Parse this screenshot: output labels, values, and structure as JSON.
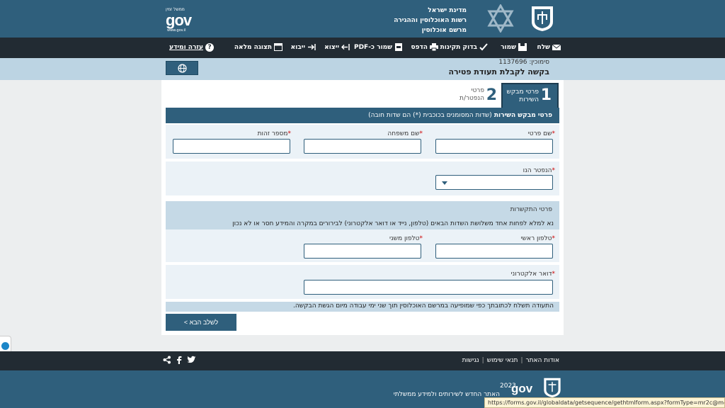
{
  "header": {
    "gov_small": "ממשל זמין",
    "gov_logo": "gov",
    "gov_url": "www.gov.il",
    "ministry_lines": [
      "מדינת ישראל",
      "רשות האוכלוסין וההגירה",
      "מרשם אוכלוסין"
    ]
  },
  "toolbar": {
    "send": "שלח",
    "save": "שמור",
    "validate": "בדוק תקינות",
    "print": "הדפס",
    "save_pdf": "שמור כ-PDF",
    "export": "ייצוא",
    "import": "ייבוא",
    "full_view": "תצוגה מלאה",
    "help": "עזרה ומידע",
    "help_mark": "?"
  },
  "subheader": {
    "reference": "סימוכין: 1137696",
    "title": "בקשה לקבלת תעודת פטירה"
  },
  "steps": [
    {
      "number": "1",
      "label": "פרטי מבקש השירות",
      "active": true
    },
    {
      "number": "2",
      "label": "פרטי הנפטר/ת",
      "active": false
    }
  ],
  "form": {
    "section_title": "פרטי מבקש השירות",
    "section_note": "(שדות המסומנים בכוכבית (*) הם שדות חובה)",
    "required_mark": "*",
    "first_name": {
      "label": "שם פרטי",
      "value": ""
    },
    "last_name": {
      "label": "שם משפחה",
      "value": ""
    },
    "id_number": {
      "label": "מספר זהות",
      "value": ""
    },
    "deceased_is": {
      "label": "הנפטר הנו",
      "value": ""
    },
    "contact_title": "פרטי התקשרות",
    "contact_note": "נא למלא לפחות אחד משלושת השדות הבאים (טלפון, נייד או דואר אלקטרוני) לבירורים במקרה והמידע חסר או לא נכון",
    "primary_phone": {
      "label": "טלפון ראשי",
      "value": ""
    },
    "secondary_phone": {
      "label": "טלפון משני",
      "value": ""
    },
    "email": {
      "label": "דואר אלקטרוני",
      "value": ""
    },
    "delivery_note": "התעודה תשלח לכתובתך כפי שמופיעה במרשם האוכלוסין תוך שני ימי עבודה מיום הגשת הבקשה.",
    "next_button": "לשלב הבא >"
  },
  "footer": {
    "links": [
      "אודות האתר",
      "תנאי שימוש",
      "נגישות"
    ],
    "year": "2023",
    "tagline": "האתר החדש לשירותים ולמידע ממשלתי",
    "gov_logo": "gov",
    "social": [
      "share-icon",
      "facebook-icon",
      "twitter-icon"
    ]
  },
  "status_url": "https://forms.gov.il/globaldata/getsequence/gethtmlform.aspx?formType=mr2c@moin.gov.il#",
  "colors": {
    "primary": "#2f5f7c",
    "toolbar": "#222b33",
    "subheader": "#bcd4e3",
    "form_block": "#ebf2f7",
    "required": "#cc0000"
  }
}
